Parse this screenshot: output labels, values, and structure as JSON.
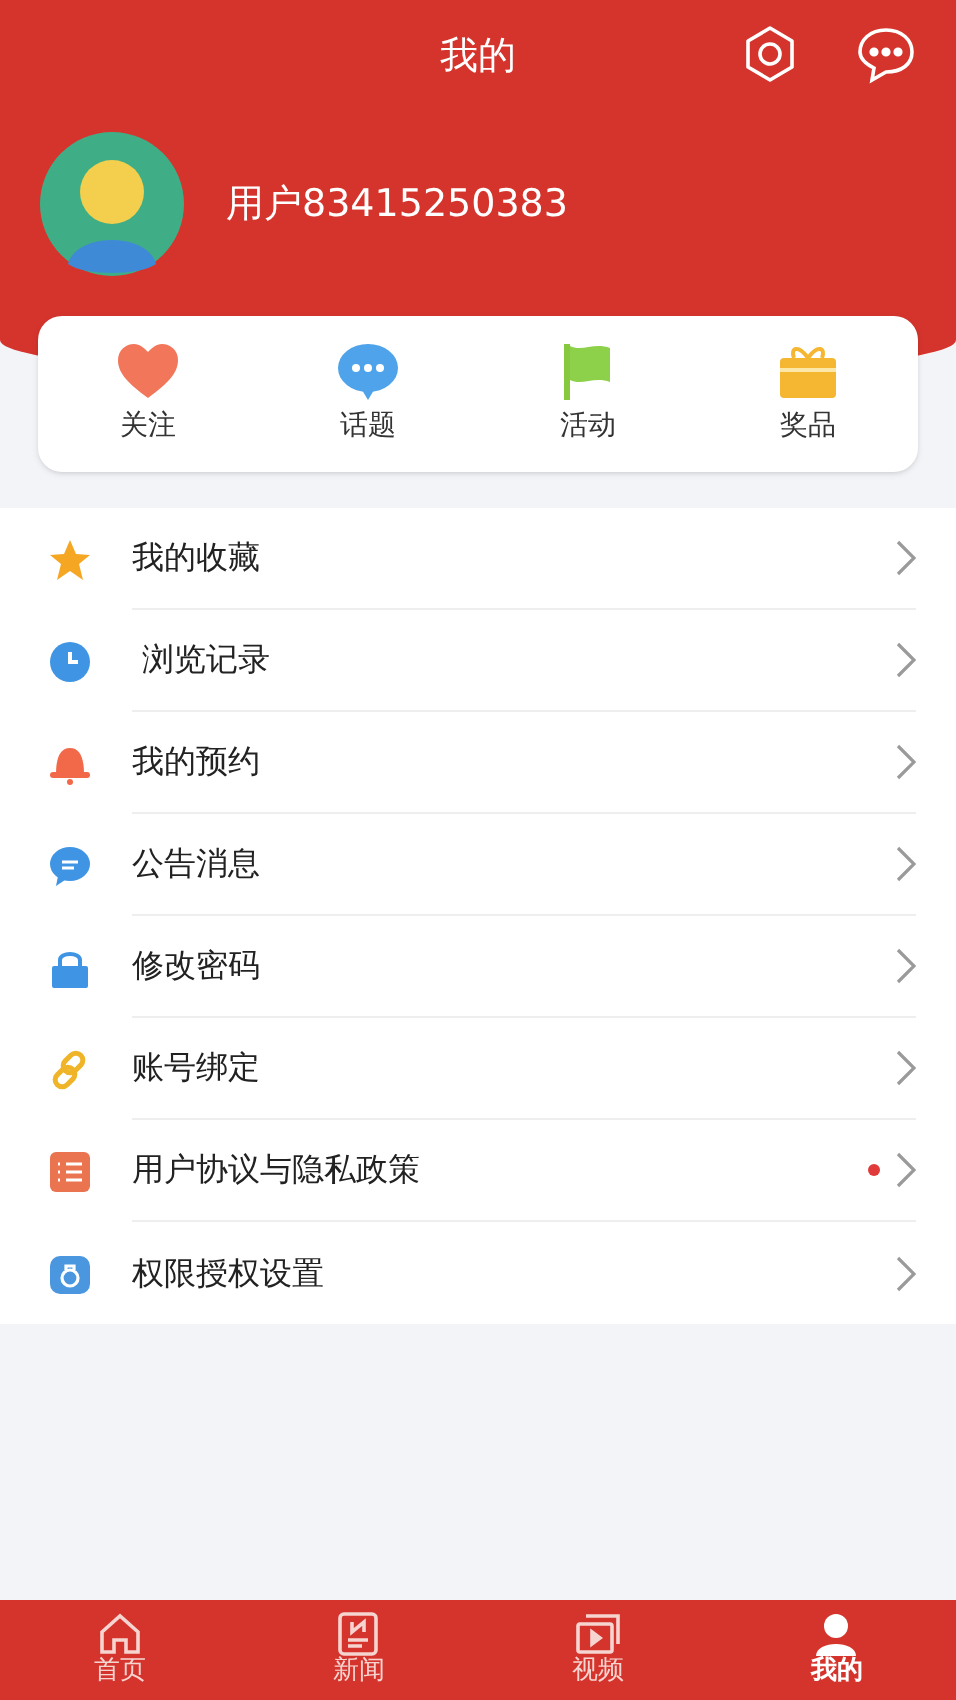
{
  "header": {
    "title": "我的"
  },
  "profile": {
    "username": "用户83415250383"
  },
  "shortcuts": [
    {
      "kind": "heart",
      "label": "关注"
    },
    {
      "kind": "chat",
      "label": "话题"
    },
    {
      "kind": "flag",
      "label": "活动"
    },
    {
      "kind": "gift",
      "label": "奖品"
    }
  ],
  "menu": [
    {
      "kind": "star",
      "label": "我的收藏",
      "dot": false
    },
    {
      "kind": "clock",
      "label": " 浏览记录",
      "dot": false
    },
    {
      "kind": "bell",
      "label": "我的预约",
      "dot": false
    },
    {
      "kind": "message",
      "label": "公告消息",
      "dot": false
    },
    {
      "kind": "lock",
      "label": "修改密码",
      "dot": false
    },
    {
      "kind": "link",
      "label": "账号绑定",
      "dot": false
    },
    {
      "kind": "list",
      "label": "用户协议与隐私政策",
      "dot": true
    },
    {
      "kind": "permission",
      "label": "权限授权设置",
      "dot": false
    }
  ],
  "tabs": [
    {
      "kind": "home",
      "label": "首页",
      "selected": false
    },
    {
      "kind": "news",
      "label": "新闻",
      "selected": false
    },
    {
      "kind": "video",
      "label": "视频",
      "selected": false
    },
    {
      "kind": "person",
      "label": "我的",
      "selected": true
    }
  ]
}
